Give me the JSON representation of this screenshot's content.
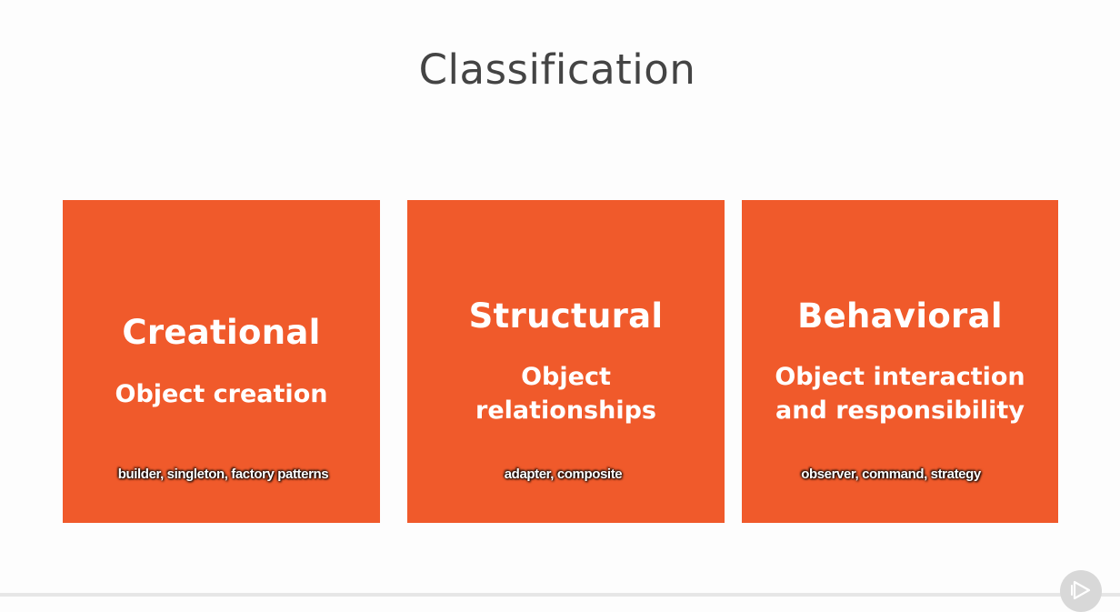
{
  "slide": {
    "title": "Classification"
  },
  "cards": [
    {
      "heading": "Creational",
      "subtitle_lines": [
        "Object creation"
      ],
      "caption": "builder, singleton, factory patterns"
    },
    {
      "heading": "Structural",
      "subtitle_lines": [
        "Object",
        "relationships"
      ],
      "caption": "adapter, composite"
    },
    {
      "heading": "Behavioral",
      "subtitle_lines": [
        "Object interaction",
        "and responsibility"
      ],
      "caption": "observer, command, strategy"
    }
  ],
  "player": {
    "icon": "play-icon"
  },
  "colors": {
    "card_background": "#f05a2b",
    "title_text": "#444444",
    "card_text": "#ffffff"
  }
}
